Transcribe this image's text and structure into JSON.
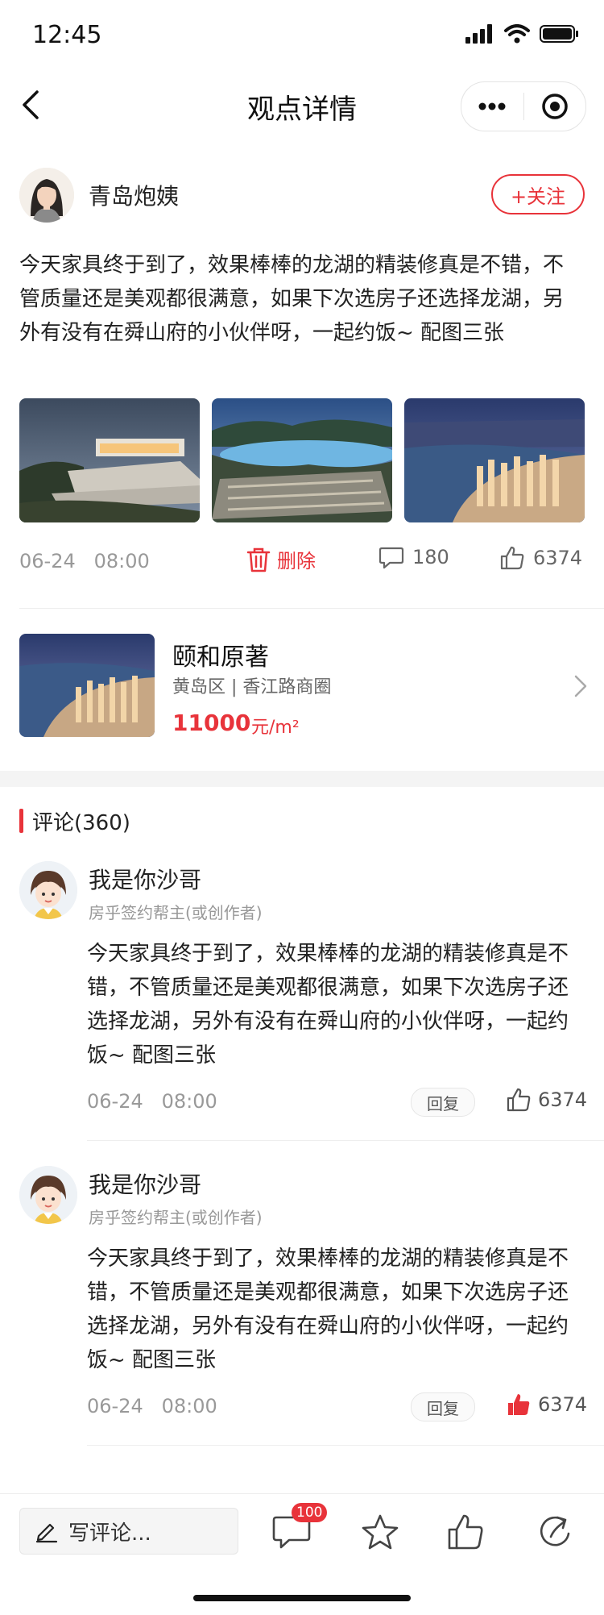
{
  "status_bar": {
    "time": "12:45"
  },
  "nav": {
    "title": "观点详情"
  },
  "author": {
    "name": "青岛炮姨",
    "follow_label": "+关注"
  },
  "post": {
    "text": "今天家具终于到了，效果棒棒的龙湖的精装修真是不错，不管质量还是美观都很满意，如果下次选房子还选择龙湖，另外有没有在舜山府的小伙伴呀，一起约饭~     配图三张",
    "date": "06-24",
    "time": "08:00",
    "delete_label": "删除",
    "comment_count": "180",
    "like_count": "6374"
  },
  "property": {
    "name": "颐和原著",
    "area": "黄岛区 | 香江路商圈",
    "price": "11000",
    "unit": "元/m²"
  },
  "comments_section": {
    "title": "评论(360)"
  },
  "comments": [
    {
      "name": "我是你沙哥",
      "role": "房乎签约帮主(或创作者)",
      "text": "今天家具终于到了，效果棒棒的龙湖的精装修真是不错，不管质量还是美观都很满意，如果下次选房子还选择龙湖，另外有没有在舜山府的小伙伴呀，一起约饭~     配图三张",
      "date": "06-24",
      "time": "08:00",
      "reply_label": "回复",
      "likes": "6374",
      "liked": false
    },
    {
      "name": "我是你沙哥",
      "role": "房乎签约帮主(或创作者)",
      "text": "今天家具终于到了，效果棒棒的龙湖的精装修真是不错，不管质量还是美观都很满意，如果下次选房子还选择龙湖，另外有没有在舜山府的小伙伴呀，一起约饭~     配图三张",
      "date": "06-24",
      "time": "08:00",
      "reply_label": "回复",
      "likes": "6374",
      "liked": true
    }
  ],
  "bottom_bar": {
    "write_placeholder": "写评论...",
    "comment_badge": "100"
  },
  "colors": {
    "accent": "#e8333a",
    "muted": "#999999"
  },
  "icons": [
    "back-icon",
    "more-icon",
    "target-icon",
    "trash-icon",
    "comment-icon",
    "thumb-up-icon",
    "pen-icon",
    "star-icon",
    "share-icon"
  ]
}
